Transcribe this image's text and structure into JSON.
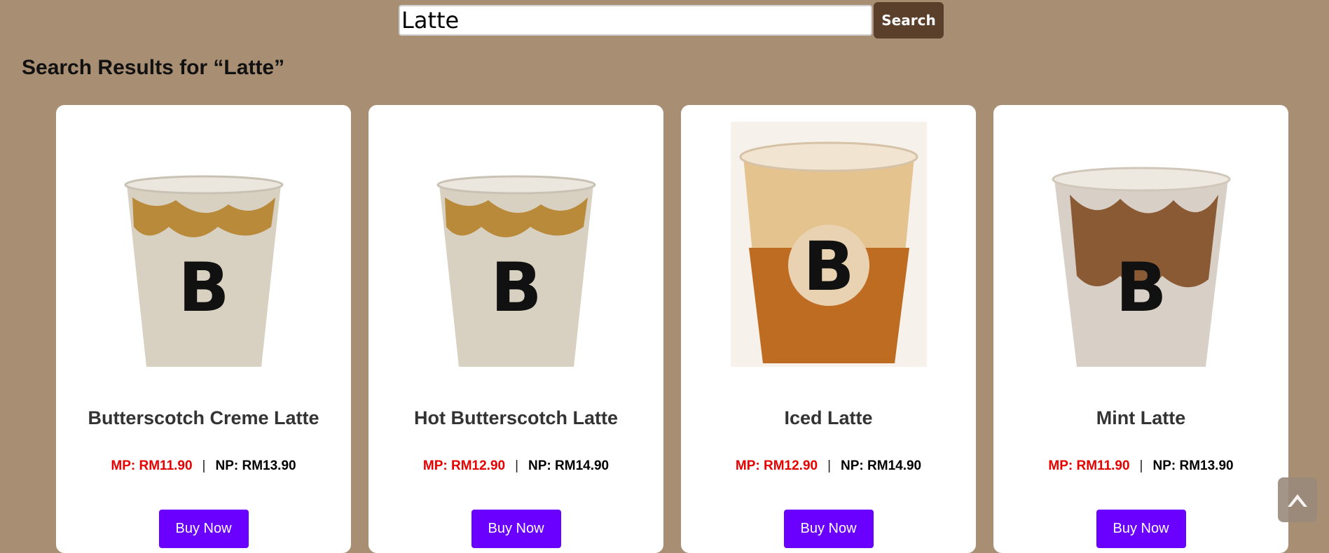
{
  "search": {
    "value": "Latte",
    "button_label": "Search"
  },
  "results": {
    "heading": "Search Results for “Latte”"
  },
  "products": [
    {
      "name": "Butterscotch Creme Latte",
      "mp_price": "MP: RM11.90",
      "np_price": "NP: RM13.90",
      "buy_label": "Buy Now"
    },
    {
      "name": "Hot Butterscotch Latte",
      "mp_price": "MP: RM12.90",
      "np_price": "NP: RM14.90",
      "buy_label": "Buy Now"
    },
    {
      "name": "Iced Latte",
      "mp_price": "MP: RM12.90",
      "np_price": "NP: RM14.90",
      "buy_label": "Buy Now"
    },
    {
      "name": "Mint Latte",
      "mp_price": "MP: RM11.90",
      "np_price": "NP: RM13.90",
      "buy_label": "Buy Now"
    }
  ],
  "separator": "|",
  "colors": {
    "page_background": "#a88f73",
    "search_button": "#5a3f2a",
    "buy_button": "#6a00ff",
    "member_price": "#e60000"
  },
  "icons": {
    "scroll_top": "chevron-up-icon"
  }
}
